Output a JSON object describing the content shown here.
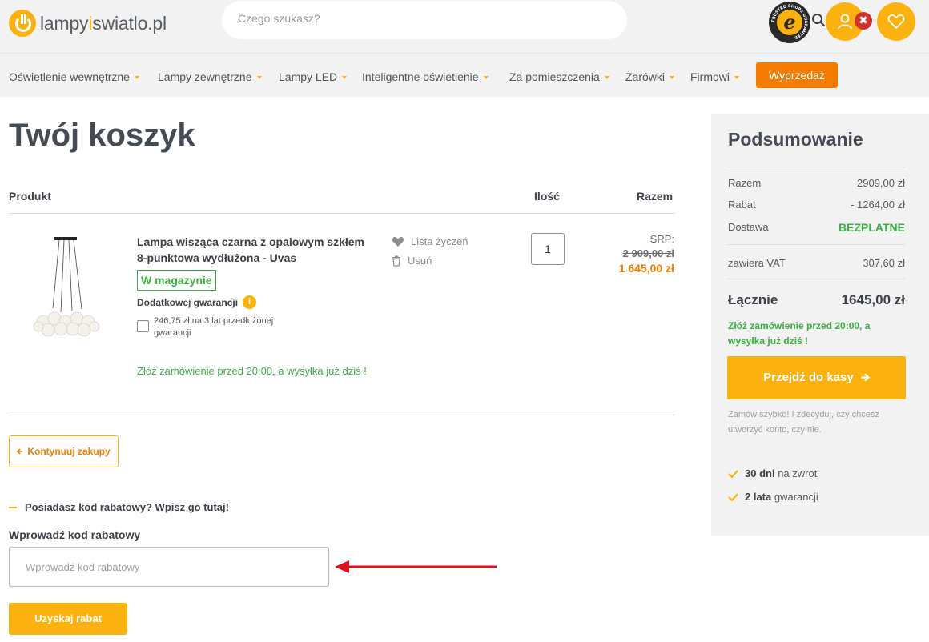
{
  "header": {
    "logo": {
      "part1": "lampy",
      "part2": "i",
      "part3": "swiatlo.pl"
    },
    "search_placeholder": "Czego szukasz?",
    "trusted_badge": "e",
    "trusted_ring_text": "TRUSTED SHOPS GUARANTEE",
    "close_badge": "✖"
  },
  "nav": {
    "items": [
      "Oświetlenie wewnętrzne",
      "Lampy zewnętrzne",
      "Lampy LED",
      "Inteligentne oświetlenie",
      "Za pomieszczenia",
      "Żarówki",
      "Firmowi"
    ],
    "sale": "Wyprzedaż"
  },
  "cart": {
    "title": "Twój koszyk",
    "columns": {
      "product": "Produkt",
      "qty": "Ilość",
      "total": "Razem"
    },
    "item": {
      "name": "Lampa wisząca czarna z opalowym szkłem 8-punktowa wydłużona - Uvas",
      "stock": "W magazynie",
      "warranty_label": "Dodatkowej gwarancji",
      "info_icon": "i",
      "warranty_option": "246,75 zł na 3 lat przedłużonej gwarancji",
      "shipping_note": "Złóż zamówienie przed 20:00, a wysyłka już dziś !",
      "wishlist": "Lista życzeń",
      "remove": "Usuń",
      "quantity": "1",
      "srp_label": "SRP:",
      "old_price": "2 909,00 zł",
      "new_price": "1 645,00 zł"
    },
    "continue": "Kontynuuj zakupy",
    "coupon_toggle": "Posiadasz kod rabatowy? Wpisz go tutaj!",
    "coupon_label": "Wprowadź kod rabatowy",
    "coupon_placeholder": "Wprowadź kod rabatowy",
    "coupon_button": "Uzyskaj rabat"
  },
  "summary": {
    "title": "Podsumowanie",
    "subtotal_label": "Razem",
    "subtotal": "2909,00 zł",
    "discount_label": "Rabat",
    "discount": "- 1264,00 zł",
    "shipping_label": "Dostawa",
    "shipping": "BEZPLATNE",
    "vat_label": "zawiera VAT",
    "vat": "307,60 zł",
    "total_label": "Łącznie",
    "total": "1645,00 zł",
    "shipping_note": "Złóż zamówienie przed 20:00, a wysyłka już dziś !",
    "checkout": "Przejdź do kasy",
    "note": "Zamów szybko! I zdecyduj, czy chcesz utworzyć konto, czy nie.",
    "perk1_bold": "30 dni",
    "perk1_rest": "na zwrot",
    "perk2_bold": "2 lata",
    "perk2_rest": "gwarancji"
  },
  "colors": {
    "accent": "#fbb20f",
    "sale": "#f57c00",
    "success": "#3cb043",
    "annotation_arrow": "#e0101a"
  }
}
